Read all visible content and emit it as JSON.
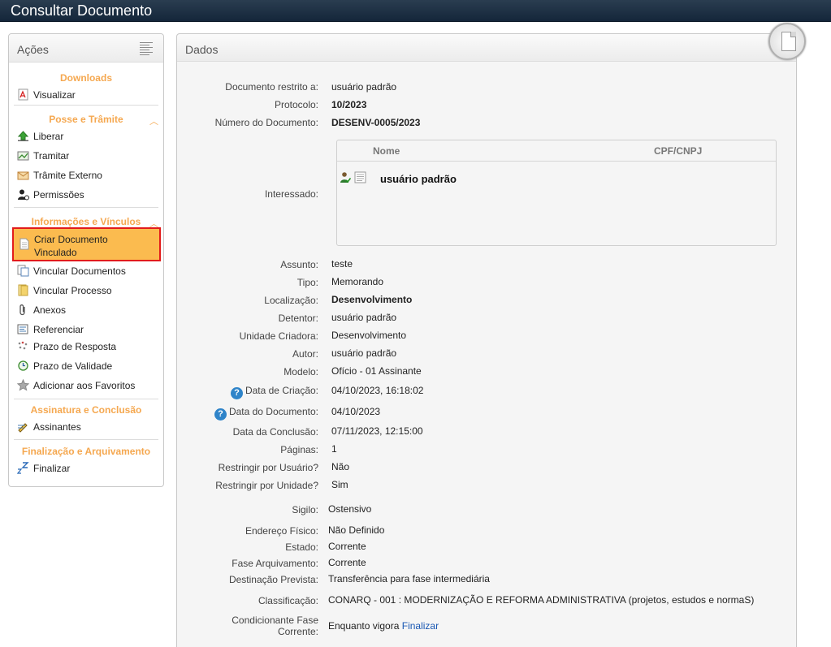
{
  "window": {
    "title": "Consultar Documento"
  },
  "sidebar": {
    "title": "Ações",
    "groups": {
      "downloads": "Downloads",
      "posse": "Posse e Trâmite",
      "info": "Informações e Vínculos",
      "assinatura": "Assinatura e Conclusão",
      "finalizacao": "Finalização e Arquivamento"
    },
    "items": {
      "visualizar": "Visualizar",
      "liberar": "Liberar",
      "tramitar": "Tramitar",
      "tramite_externo": "Trâmite Externo",
      "permissoes": "Permissões",
      "criar_1": "Criar Documento",
      "criar_2": "Vinculado",
      "vincular_documentos": "Vincular Documentos",
      "vincular_processo": "Vincular Processo",
      "anexos": "Anexos",
      "referenciar": "Referenciar",
      "prazo_resposta": "Prazo de Resposta",
      "prazo_validade": "Prazo de Validade",
      "favoritos": "Adicionar aos Favoritos",
      "assinantes": "Assinantes",
      "finalizar": "Finalizar"
    }
  },
  "panel": {
    "title": "Dados",
    "fields": {
      "restrito_label": "Documento restrito a:",
      "restrito_value": "usuário padrão",
      "protocolo_label": "Protocolo:",
      "protocolo_value": "10/2023",
      "numero_label": "Número do Documento:",
      "numero_value": "DESENV-0005/2023",
      "interessado_label": "Interessado:",
      "assunto_label": "Assunto:",
      "assunto_value": "teste",
      "tipo_label": "Tipo:",
      "tipo_value": "Memorando",
      "localizacao_label": "Localização:",
      "localizacao_value": "Desenvolvimento",
      "detentor_label": "Detentor:",
      "detentor_value": "usuário padrão",
      "unidade_label": "Unidade Criadora:",
      "unidade_value": "Desenvolvimento",
      "autor_label": "Autor:",
      "autor_value": "usuário padrão",
      "modelo_label": "Modelo:",
      "modelo_value": "Ofício - 01 Assinante",
      "criacao_label": "Data de Criação:",
      "criacao_value": "04/10/2023, 16:18:02",
      "data_doc_label": "Data do Documento:",
      "data_doc_value": "04/10/2023",
      "conclusao_label": "Data da Conclusão:",
      "conclusao_value": "07/11/2023, 12:15:00",
      "paginas_label": "Páginas:",
      "paginas_value": "1",
      "restr_usuario_label": "Restringir por Usuário?",
      "restr_usuario_value": "Não",
      "restr_unidade_label": "Restringir por Unidade?",
      "restr_unidade_value": "Sim",
      "sigilo_label": "Sigilo:",
      "sigilo_value": "Ostensivo",
      "endereco_label": "Endereço Físico:",
      "endereco_value": "Não Definido",
      "estado_label": "Estado:",
      "estado_value": "Corrente",
      "fase_label": "Fase Arquivamento:",
      "fase_value": "Corrente",
      "destinacao_label": "Destinação Prevista:",
      "destinacao_value": "Transferência para fase intermediária",
      "classificacao_label": "Classificação:",
      "classificacao_value": "CONARQ - 001 : MODERNIZAÇÃO E REFORMA ADMINISTRATIVA (projetos, estudos e normaS)",
      "condicionante_label_1": "Condicionante Fase",
      "condicionante_label_2": "Corrente:",
      "condicionante_value": "Enquanto vigora",
      "condicionante_link": "Finalizar"
    },
    "interessados": {
      "col_nome": "Nome",
      "col_cpf": "CPF/CNPJ",
      "rows": [
        {
          "nome": "usuário padrão",
          "cpf": ""
        }
      ]
    }
  },
  "colors": {
    "accent_orange": "#f5a850",
    "highlight": "#fbbb4f",
    "highlight_border": "#e21b1b",
    "topbar": "#1d3145",
    "link": "#1a58b3"
  }
}
